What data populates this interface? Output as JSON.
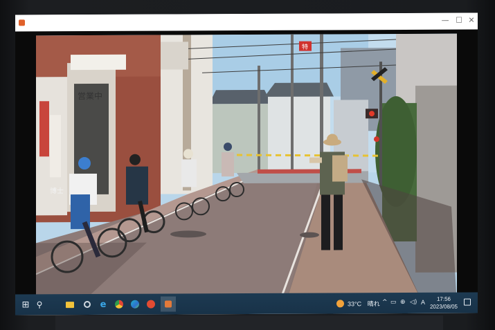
{
  "photo_viewer": {
    "title": "",
    "controls": {
      "minimize": "—",
      "maximize": "☐",
      "close": "✕"
    },
    "photo": {
      "signs": {
        "shop_banner": "営業中",
        "side_sign": "博士",
        "flag_small": "特"
      }
    }
  },
  "taskbar": {
    "start": "⊞",
    "search": "⚲",
    "weather": {
      "temperature": "33°C",
      "condition": "晴れ"
    },
    "ime": "A",
    "clock": {
      "time": "17:56",
      "date": "2023/08/05"
    }
  },
  "colors": {
    "taskbar": "#1b3650",
    "sky": "#b9d6ea",
    "brick_road": "#8d7b78"
  }
}
